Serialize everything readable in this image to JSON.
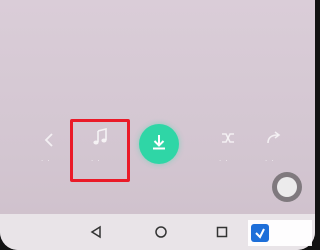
{
  "toolbar": {
    "items": [
      {
        "icon": "back-arrow-icon",
        "label": "·  ·"
      },
      {
        "icon": "music-note-icon",
        "label": "·  ·"
      },
      {
        "icon": "download-icon",
        "label": ""
      },
      {
        "icon": "shuffle-icon",
        "label": "·  ·"
      },
      {
        "icon": "share-icon",
        "label": "·  ·"
      }
    ]
  },
  "navigation": {
    "back": "back-triangle-icon",
    "home": "home-circle-icon",
    "recents": "recents-square-icon"
  },
  "colors": {
    "highlight": "#ea1a28",
    "download_button": "#2fd6a6",
    "screen_background": "#d4c7d2",
    "navbar": "#e9e4e8",
    "watermark_accent": "#1e6fd9"
  },
  "watermark": {
    "text": "",
    "logo": "app-logo"
  }
}
